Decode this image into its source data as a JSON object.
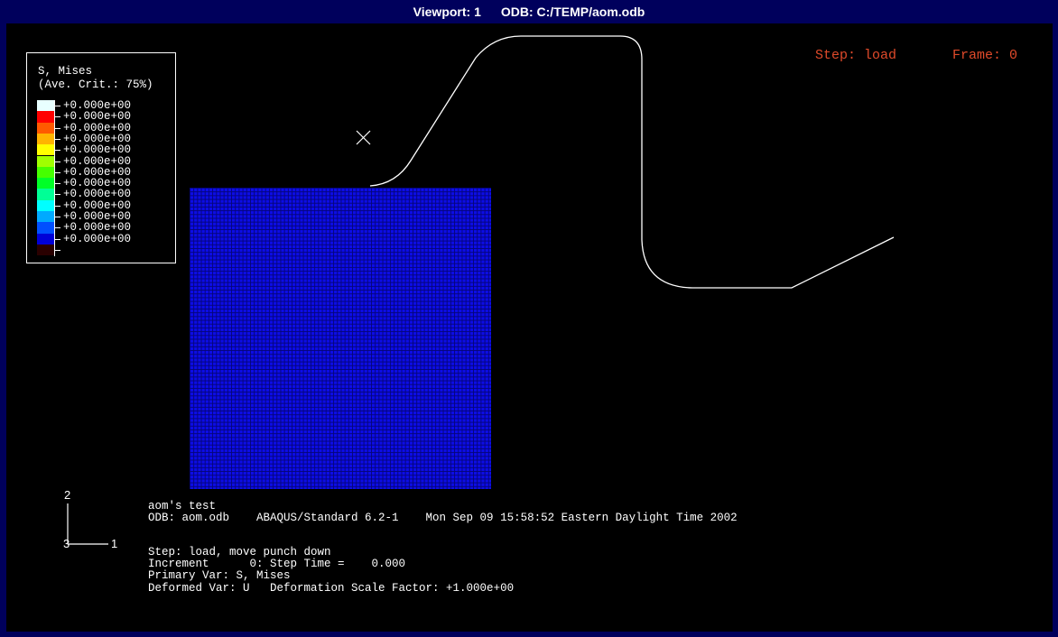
{
  "titlebar": {
    "viewport": "Viewport: 1",
    "odb": "ODB: C:/TEMP/aom.odb"
  },
  "legend": {
    "title": "S, Mises",
    "subtitle": "(Ave. Crit.: 75%)",
    "entries": [
      {
        "value": "+0.000e+00",
        "color": "#e8ffff"
      },
      {
        "value": "+0.000e+00",
        "color": "#ff0000"
      },
      {
        "value": "+0.000e+00",
        "color": "#ff5a00"
      },
      {
        "value": "+0.000e+00",
        "color": "#ffb400"
      },
      {
        "value": "+0.000e+00",
        "color": "#ffff00"
      },
      {
        "value": "+0.000e+00",
        "color": "#a0ff00"
      },
      {
        "value": "+0.000e+00",
        "color": "#46ff00"
      },
      {
        "value": "+0.000e+00",
        "color": "#00ff28"
      },
      {
        "value": "+0.000e+00",
        "color": "#00ff96"
      },
      {
        "value": "+0.000e+00",
        "color": "#00ffff"
      },
      {
        "value": "+0.000e+00",
        "color": "#00aaff"
      },
      {
        "value": "+0.000e+00",
        "color": "#0050ff"
      },
      {
        "value": "+0.000e+00",
        "color": "#0000d8"
      },
      {
        "value": "",
        "color": "#2a0000"
      }
    ]
  },
  "step_label": "Step: load",
  "frame_label": "Frame: 0",
  "triad": {
    "axis_2": "2",
    "axis_1": "1",
    "axis_3": "3"
  },
  "info": {
    "title": "aom's test",
    "odb_line": "ODB: aom.odb    ABAQUS/Standard 6.2-1    Mon Sep 09 15:58:52 Eastern Daylight Time 2002",
    "step_line": "Step: load, move punch down",
    "increment_line": "Increment      0: Step Time =    0.000",
    "primary_line": "Primary Var: S, Mises",
    "deformed_line": "Deformed Var: U   Deformation Scale Factor: +1.000e+00"
  },
  "colors": {
    "viewport_bg": "#000000",
    "frame_bg": "#00005c",
    "mesh": "#0d0de6",
    "annotation_red": "#e04a2a"
  }
}
